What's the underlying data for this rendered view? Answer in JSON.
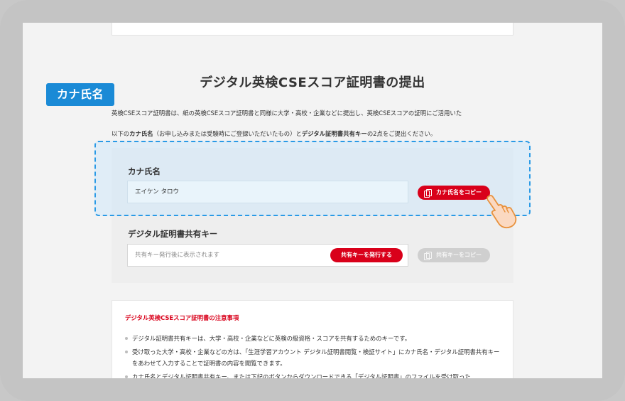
{
  "page": {
    "title": "デジタル英検CSEスコア証明書の提出",
    "intro_line1": "英検CSEスコア証明書は、紙の英検CSEスコア証明書と同様に大学・高校・企業などに提出し、英検CSEスコアの証明にご活用いた",
    "intro_line2_pre": "以下の",
    "intro_line2_kana": "カナ氏名",
    "intro_line2_mid": "（お申し込みまたは受験時にご登録いただいたもの）と",
    "intro_line2_key": "デジタル証明書共有キー",
    "intro_line2_post": "の2点をご提出ください。"
  },
  "callout": {
    "label": "カナ氏名"
  },
  "form": {
    "kana": {
      "label": "カナ氏名",
      "value": "エイケン タロウ",
      "copy_button": "カナ氏名をコピー"
    },
    "key": {
      "label": "デジタル証明書共有キー",
      "placeholder": "共有キー発行後に表示されます",
      "issue_button": "共有キーを発行する",
      "copy_button": "共有キーをコピー"
    }
  },
  "notes": {
    "title": "デジタル英検CSEスコア証明書の注意事項",
    "items": [
      "デジタル証明書共有キーは、大学・高校・企業などに英検の級資格・スコアを共有するためのキーです。",
      "受け取った大学・高校・企業などの方は、「生涯学習アカウント デジタル証明書閲覧・検証サイト」にカナ氏名・デジタル証明書共有キーをあわせて入力することで証明書の内容を閲覧できます。",
      "カナ氏名とデジタル証明書共有キー、または下記のボタンからダウンロードできる「デジタル証明書」のファイルを受け取った"
    ]
  },
  "colors": {
    "accent_red": "#d9001a",
    "callout_blue": "#1a8ad6",
    "highlight_border": "#2a9ae6"
  },
  "icons": {
    "copy": "copy-icon",
    "pointer": "pointing-hand-icon"
  }
}
